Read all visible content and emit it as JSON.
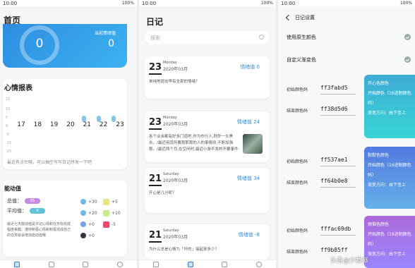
{
  "status": {
    "time": "10:00",
    "battery": "100%"
  },
  "home": {
    "title": "首页",
    "ring_value": "0",
    "today_label": "当前情绪值",
    "today_value": "0",
    "mood_title": "心情报表",
    "y_ticks": [
      "25",
      "15",
      "5",
      "0",
      "-5",
      "-15",
      "-25"
    ],
    "days": [
      "17",
      "18",
      "19",
      "20",
      "21",
      "22",
      "23"
    ],
    "mood_note": "最近有点忙哦，可以抽空写写日记抒发一下吧",
    "energy_title": "能动值",
    "total_label": "总值：",
    "total_value": "65",
    "avg_label": "平均值：",
    "avg_value": "9",
    "energy_note": "最近七天能动值是日记心情和任务标完成程度来截。谨持积极心情和积极完成自己的任务就会增加能动值哦",
    "chips": [
      "+30",
      "+20",
      "+0",
      "+0"
    ],
    "chips_right": [
      "+5",
      "+10",
      "-5"
    ]
  },
  "diary": {
    "title": "日记",
    "search_placeholder": "搜索",
    "entries": [
      {
        "day": "23",
        "weekday": "Monday",
        "ym": "2020年03月",
        "mood": "情绪值 0",
        "text": "单纯地提出早有全部的情绪？"
      },
      {
        "day": "23",
        "weekday": "Monday",
        "ym": "2020年03月",
        "mood": "情绪值 24",
        "text": "各个业余都有好多门道吧,作为作行人,肝肝一头黑水。/最近用其所要那那那的人的事情抑,不断加强那。/最近两个月,在空闲时,最近小游不发的不要事件"
      },
      {
        "day": "21",
        "weekday": "Saturday",
        "ym": "2020年03月",
        "mood": "情绪值 34",
        "text": "开心是几分呢？"
      },
      {
        "day": "21",
        "weekday": "Saturday",
        "ym": "2020年03月",
        "mood": "情绪值 -8",
        "text": "为什么总是心情为「坏的」接起来多少？"
      }
    ]
  },
  "settings": {
    "title": "日记设置",
    "opt1": "使用原生颜色",
    "opt2": "自定义渐变色",
    "start_label": "初始颜色码",
    "end_label": "结束颜色码",
    "schemes": [
      {
        "start": "ff3fabd5",
        "end": "ff38d5d6",
        "l1": "开心色颜色",
        "l2": "开始颜色（16进制颜色码）",
        "l3": "渐变方向：由下至上"
      },
      {
        "start": "ff537ae1",
        "end": "ff64b0e8",
        "l1": "默默色颜色",
        "l2": "开始颜色（16进制颜色码）",
        "l3": "渐变方向：由下至上"
      },
      {
        "start": "fffac69db",
        "end": "ff9b85ff",
        "l1": "烦恼色颜色",
        "l2": "开始颜色（16进制颜色码）",
        "l3": "渐变方向：由下至上"
      }
    ]
  },
  "watermark": "头条@少数派"
}
